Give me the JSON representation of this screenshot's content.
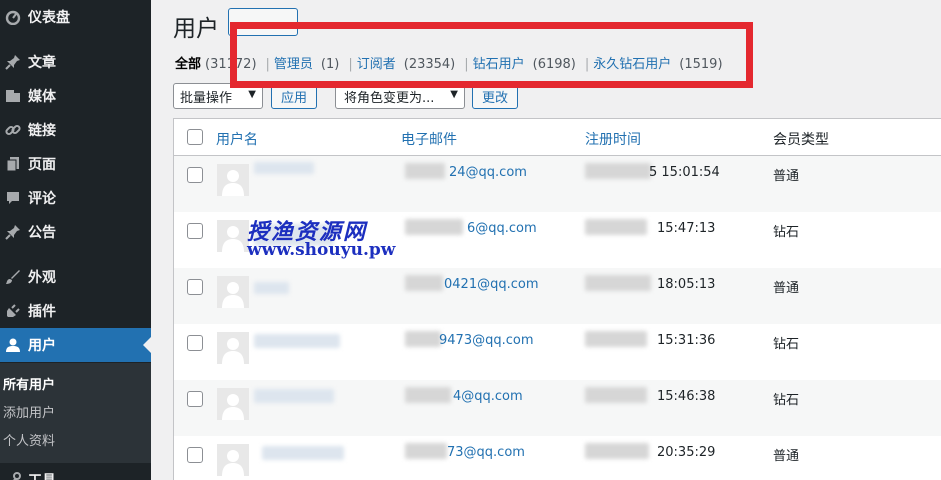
{
  "sidebar": {
    "items": [
      {
        "label": "仪表盘",
        "icon": "dashboard-icon"
      },
      {
        "label": "文章",
        "icon": "pin-icon"
      },
      {
        "label": "媒体",
        "icon": "media-icon"
      },
      {
        "label": "链接",
        "icon": "link-icon"
      },
      {
        "label": "页面",
        "icon": "page-icon"
      },
      {
        "label": "评论",
        "icon": "comment-icon"
      },
      {
        "label": "公告",
        "icon": "pin-icon"
      },
      {
        "label": "外观",
        "icon": "brush-icon"
      },
      {
        "label": "插件",
        "icon": "plugin-icon"
      },
      {
        "label": "用户",
        "icon": "user-icon"
      },
      {
        "label": "工具",
        "icon": "tools-icon"
      }
    ],
    "active": "用户",
    "submenu": [
      "所有用户",
      "添加用户",
      "个人资料"
    ]
  },
  "header": {
    "title": "用户",
    "add_new_label": ""
  },
  "filters": {
    "all_label": "全部",
    "all_count": "(31172)",
    "items": [
      {
        "label": "管理员",
        "count": "(1)"
      },
      {
        "label": "订阅者",
        "count": "(23354)"
      },
      {
        "label": "钻石用户",
        "count": "(6198)"
      },
      {
        "label": "永久钻石用户",
        "count": "(1519)"
      }
    ]
  },
  "actions": {
    "bulk_label": "批量操作",
    "apply_label": "应用",
    "role_label": "将角色变更为...",
    "change_label": "更改"
  },
  "table": {
    "headers": {
      "username": "用户名",
      "email": "电子邮件",
      "registered": "注册时间",
      "member_type": "会员类型"
    },
    "rows": [
      {
        "email": "24@qq.com",
        "time": "5 15:01:54",
        "type": "普通"
      },
      {
        "email": "6@qq.com",
        "time": "15:47:13",
        "type": "钻石"
      },
      {
        "email": "0421@qq.com",
        "time": "18:05:13",
        "type": "普通"
      },
      {
        "email": "9473@qq.com",
        "time": "15:31:36",
        "type": "钻石"
      },
      {
        "email": "4@qq.com",
        "time": "15:46:38",
        "type": "钻石"
      },
      {
        "email": "73@qq.com",
        "time": "20:35:29",
        "type": "普通"
      }
    ]
  },
  "watermark": {
    "line1": "授渔资源网",
    "line2": "www.shouyu.pw"
  },
  "colors": {
    "sidebar_bg": "#1d2327",
    "active_bg": "#2271b1",
    "link": "#2271b1",
    "highlight_box": "#e4282f",
    "watermark": "#1c2fbf"
  }
}
